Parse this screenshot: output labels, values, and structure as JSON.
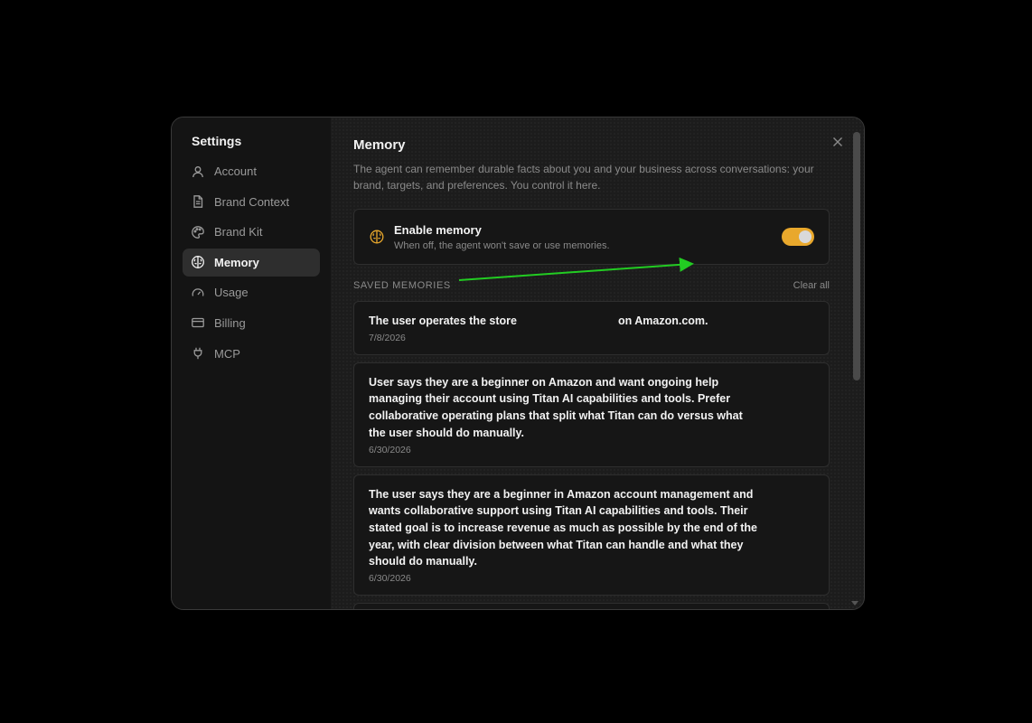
{
  "sidebar": {
    "title": "Settings",
    "items": [
      {
        "label": "Account",
        "icon": "user-icon",
        "active": false
      },
      {
        "label": "Brand Context",
        "icon": "document-icon",
        "active": false
      },
      {
        "label": "Brand Kit",
        "icon": "palette-icon",
        "active": false
      },
      {
        "label": "Memory",
        "icon": "brain-icon",
        "active": true
      },
      {
        "label": "Usage",
        "icon": "gauge-icon",
        "active": false
      },
      {
        "label": "Billing",
        "icon": "credit-card-icon",
        "active": false
      },
      {
        "label": "MCP",
        "icon": "plug-icon",
        "active": false
      }
    ]
  },
  "main": {
    "title": "Memory",
    "description": "The agent can remember durable facts about you and your business across conversations: your brand, targets, and preferences. You control it here.",
    "toggle": {
      "title": "Enable memory",
      "subtitle": "When off, the agent won't save or use memories.",
      "enabled": true,
      "icon": "brain-icon"
    },
    "section_label": "SAVED MEMORIES",
    "clear_all_label": "Clear all",
    "memories": [
      {
        "text_before": "The user operates the store",
        "text_after": "on Amazon.com.",
        "date": "7/8/2026"
      },
      {
        "text": "User says they are a beginner on Amazon and want ongoing help managing their account using Titan AI capabilities and tools. Prefer collaborative operating plans that split what Titan can do versus what the user should do manually.",
        "date": "6/30/2026"
      },
      {
        "text": "The user says they are a beginner in Amazon account management and wants collaborative support using Titan AI capabilities and tools. Their stated goal is to increase revenue as much as possible by the end of the year, with clear division between what Titan can handle and what they should do manually.",
        "date": "6/30/2026"
      }
    ]
  },
  "colors": {
    "accent": "#e9a82c",
    "annotation_arrow": "#22cc22",
    "background": "#000000",
    "panel": "#1c1c1c",
    "sidebar": "#141414"
  }
}
